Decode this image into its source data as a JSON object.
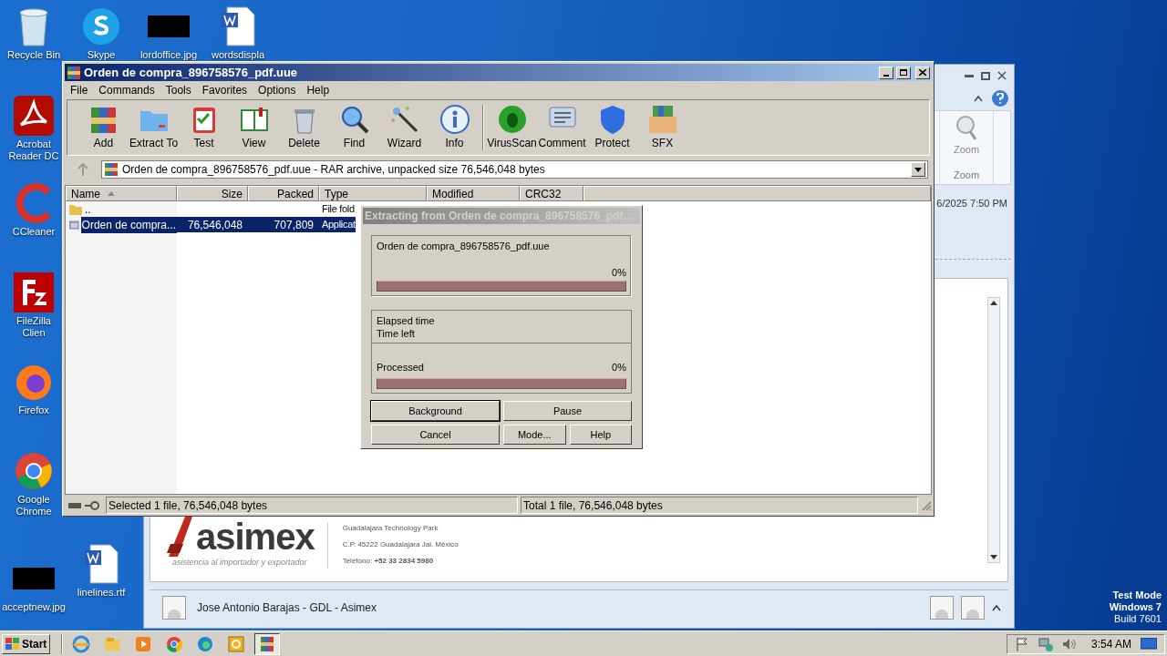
{
  "desktop_icons": [
    {
      "label": "Recycle Bin",
      "kind": "recycle"
    },
    {
      "label": "Skype",
      "kind": "skype"
    },
    {
      "label": "lordoffice.jpg",
      "kind": "image"
    },
    {
      "label": "wordsdispla",
      "kind": "word"
    },
    {
      "label": "Acrobat Reader DC",
      "kind": "acrobat"
    },
    {
      "label": "CCleaner",
      "kind": "ccleaner"
    },
    {
      "label": "FileZilla Clien",
      "kind": "filezilla"
    },
    {
      "label": "Firefox",
      "kind": "firefox"
    },
    {
      "label": "Google Chrome",
      "kind": "chrome"
    },
    {
      "label": "acceptnew.jpg",
      "kind": "image"
    },
    {
      "label": "linelines.rtf",
      "kind": "word"
    }
  ],
  "mail_window": {
    "ribbon_button": "Zoom",
    "ribbon_group": "Zoom",
    "date": "6/2025 7:50 PM",
    "signature": {
      "logo": "asimex",
      "tagline": "asistencia al importador y exportador",
      "lines": [
        "Guadalajara Technology Park",
        "C.P. 45222 Guadalajara Jal. México",
        "Teléfono: **+52 33 2834 5980**"
      ]
    },
    "sender": "Jose Antonio Barajas - GDL - Asimex"
  },
  "archiver": {
    "title": "Orden de compra_896758576_pdf.uue",
    "menu": [
      "File",
      "Commands",
      "Tools",
      "Favorites",
      "Options",
      "Help"
    ],
    "toolbar": [
      {
        "label": "Add",
        "kind": "add"
      },
      {
        "label": "Extract To",
        "kind": "extract"
      },
      {
        "label": "Test",
        "kind": "test"
      },
      {
        "label": "View",
        "kind": "view"
      },
      {
        "label": "Delete",
        "kind": "delete"
      },
      {
        "label": "Find",
        "kind": "find"
      },
      {
        "label": "Wizard",
        "kind": "wizard"
      },
      {
        "label": "Info",
        "kind": "info"
      },
      {
        "label": "VirusScan",
        "kind": "virus"
      },
      {
        "label": "Comment",
        "kind": "comment"
      },
      {
        "label": "Protect",
        "kind": "protect"
      },
      {
        "label": "SFX",
        "kind": "sfx"
      }
    ],
    "address": "Orden de compra_896758576_pdf.uue - RAR archive, unpacked size 76,546,048 bytes",
    "columns": [
      {
        "label": "Name",
        "sorted": true
      },
      {
        "label": "Size",
        "sorted": false
      },
      {
        "label": "Packed",
        "sorted": false
      },
      {
        "label": "Type",
        "sorted": false
      },
      {
        "label": "Modified",
        "sorted": false
      },
      {
        "label": "CRC32",
        "sorted": false
      }
    ],
    "rows": [
      {
        "kind": "folder",
        "name": "..",
        "size": "",
        "packed": "",
        "type": "File fold",
        "selected": false
      },
      {
        "kind": "file",
        "name": "Orden de compra...",
        "size": "76,546,048",
        "packed": "707,809",
        "type": "Applicat",
        "selected": true
      }
    ],
    "status_left": "Selected 1 file, 76,546,048 bytes",
    "status_right": "Total 1 file, 76,546,048 bytes"
  },
  "dialog": {
    "title": "Extracting from Orden de compra_896758576_pdf...",
    "file": "Orden de compra_896758576_pdf.uue",
    "file_percent": "0%",
    "file_progress": {
      "level": 0
    },
    "elapsed_label": "Elapsed time",
    "left_label": "Time left",
    "processed_label": "Processed",
    "processed_percent": "0%",
    "processed_progress": {
      "level": 0
    },
    "buttons": [
      {
        "label": "Background",
        "focused": true
      },
      {
        "label": "Pause",
        "focused": false
      },
      {
        "label": "Cancel",
        "focused": false
      },
      {
        "label": "Mode...",
        "focused": false
      },
      {
        "label": "Help",
        "focused": false
      }
    ]
  },
  "os_notice": [
    "Test Mode",
    "Windows 7",
    "Build 7601"
  ],
  "taskbar": {
    "start": "Start",
    "items": [
      {
        "kind": "ie",
        "selected": false
      },
      {
        "kind": "explorer",
        "selected": false
      },
      {
        "kind": "media",
        "selected": false
      },
      {
        "kind": "chrome",
        "selected": false
      },
      {
        "kind": "edge",
        "selected": false
      },
      {
        "kind": "outlook",
        "selected": false
      },
      {
        "kind": "winrar",
        "selected": true
      }
    ],
    "clock": "3:54 AM"
  }
}
